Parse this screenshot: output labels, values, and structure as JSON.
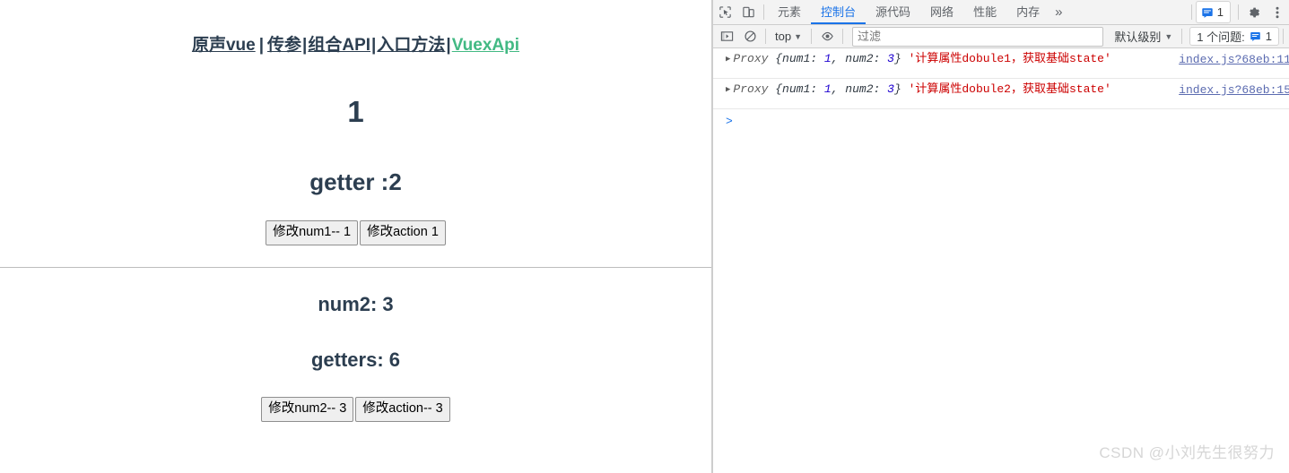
{
  "page": {
    "nav": {
      "links": [
        {
          "label": "原声vue",
          "active": false
        },
        {
          "label": "传参",
          "active": false
        },
        {
          "label": "组合API",
          "active": false
        },
        {
          "label": "入口方法",
          "active": false
        },
        {
          "label": "VuexApi",
          "active": true
        }
      ],
      "separator": "|",
      "active_color": "#42b983",
      "text_color": "#2c3e50"
    },
    "section1": {
      "value": "1",
      "getter_line": "getter :2",
      "buttons": [
        {
          "label": "修改num1-- 1"
        },
        {
          "label": "修改action 1"
        }
      ]
    },
    "section2": {
      "num_line": "num2: 3",
      "getter_line": "getters: 6",
      "buttons": [
        {
          "label": "修改num2-- 3"
        },
        {
          "label": "修改action-- 3"
        }
      ]
    },
    "watermark": "CSDN @小刘先生很努力"
  },
  "devtools": {
    "toolbar": {
      "inspect_icon": "inspect-element-icon",
      "device_icon": "device-toolbar-icon",
      "tabs": [
        {
          "label": "元素",
          "active": false
        },
        {
          "label": "控制台",
          "active": true
        },
        {
          "label": "源代码",
          "active": false
        },
        {
          "label": "网络",
          "active": false
        },
        {
          "label": "性能",
          "active": false
        },
        {
          "label": "内存",
          "active": false
        }
      ],
      "more_tabs": "»",
      "message_count": "1",
      "settings_icon": "gear-icon",
      "menu_icon": "kebab-menu-icon",
      "accent_color": "#1a73e8"
    },
    "console_bar": {
      "sidebar_toggle_icon": "console-sidebar-icon",
      "clear_icon": "clear-console-icon",
      "context": "top",
      "eye_icon": "live-expression-icon",
      "filter_placeholder": "过滤",
      "filter_value": "",
      "level": "默认级别",
      "issues_label": "1 个问题:",
      "issues_count": "1"
    },
    "logs": [
      {
        "object_prefix": "Proxy",
        "object_body": "{num1: 1, num2: 3}",
        "keys": [
          {
            "key": "num1",
            "value": "1"
          },
          {
            "key": "num2",
            "value": "3"
          }
        ],
        "message": "'计算属性dobule1，获取基础state'",
        "source": "index.js?68eb:11"
      },
      {
        "object_prefix": "Proxy",
        "object_body": "{num1: 1, num2: 3}",
        "keys": [
          {
            "key": "num1",
            "value": "1"
          },
          {
            "key": "num2",
            "value": "3"
          }
        ],
        "message": "'计算属性dobule2，获取基础state'",
        "source": "index.js?68eb:15"
      }
    ],
    "prompt": ">"
  }
}
